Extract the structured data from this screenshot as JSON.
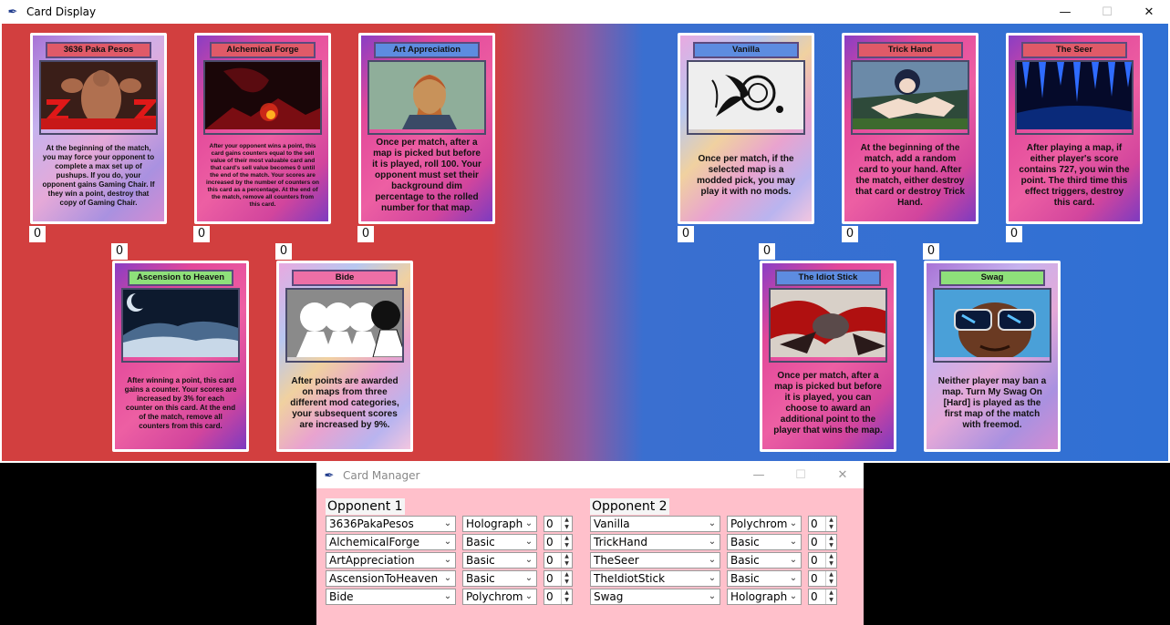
{
  "display_window": {
    "title": "Card Display",
    "controls": {
      "minimize": "—",
      "maximize": "☐",
      "close": "✕"
    }
  },
  "opponent1_cards": [
    {
      "name": "3636 Paka Pesos",
      "tier": "Holographic",
      "label_color": "#e05a68",
      "counter": "0",
      "text": "At the beginning of the match, you may force your opponent to complete a max set up of pushups. If you do, your opponent gains Gaming Chair. If they win a point, destroy that copy of Gaming Chair.",
      "art": "muscle-man-art"
    },
    {
      "name": "Alchemical Forge",
      "tier": "Basic",
      "label_color": "#e05a68",
      "counter": "0",
      "text": "After your opponent wins a point, this card gains counters equal to the sell value of their most valuable card and that card's sell value becomes 0 until the end of the match. Your scores are increased by the number of counters on this card as a percentage. At the end of the match, remove all counters from this card.",
      "art": "forge-fire-art"
    },
    {
      "name": "Art Appreciation",
      "tier": "Basic",
      "label_color": "#5d8ce0",
      "counter": "0",
      "text": "Once per match, after a map is picked but before it is played, roll 100. Your opponent must set their background dim percentage to the rolled number for that map.",
      "art": "portrait-painting-art"
    },
    {
      "name": "Ascension to Heaven",
      "tier": "Basic",
      "label_color": "#8ee07a",
      "counter": "0",
      "text": "After winning a point, this card gains a counter. Your scores are increased by 3% for each counter on this card. At the end of the match, remove all counters from this card.",
      "art": "cloud-planet-art"
    },
    {
      "name": "Bide",
      "tier": "Polychrome",
      "label_color": "#ee6fa6",
      "counter": "0",
      "text": "After points are awarded on maps from three different mod categories, your subsequent scores are increased by 9%.",
      "art": "anime-silhouette-art"
    }
  ],
  "opponent2_cards": [
    {
      "name": "Vanilla",
      "tier": "Polychrome",
      "label_color": "#5d8ce0",
      "counter": "0",
      "text": "Once per match, if the selected map is a modded pick, you may play it with no mods.",
      "art": "ink-splash-art"
    },
    {
      "name": "Trick Hand",
      "tier": "Basic",
      "label_color": "#e05a68",
      "counter": "0",
      "text": "At the beginning of the match, add a random card to your hand. After the match, either destroy that card or destroy Trick Hand.",
      "art": "anime-hand-art"
    },
    {
      "name": "The Seer",
      "tier": "Basic",
      "label_color": "#e05a68",
      "counter": "0",
      "text": "After playing a map, if either player's score contains 727, you win the point. The third time this effect triggers, destroy this card.",
      "art": "blue-crystal-art"
    },
    {
      "name": "The Idiot Stick",
      "tier": "Basic",
      "label_color": "#5d8ce0",
      "counter": "0",
      "text": "Once per match, after a map is picked but before it is played, you can choose to award an additional point to the player that wins the map.",
      "art": "red-chaos-art"
    },
    {
      "name": "Swag",
      "tier": "Holographic",
      "label_color": "#8ee07a",
      "counter": "0",
      "text": "Neither player may ban a map. Turn My Swag On [Hard] is played as the first map of the match with freemod.",
      "art": "sunglasses-man-art"
    }
  ],
  "manager_window": {
    "title": "Card Manager",
    "controls": {
      "minimize": "—",
      "maximize": "☐",
      "close": "✕"
    },
    "opponent1_label": "Opponent 1",
    "opponent2_label": "Opponent 2",
    "opponent1_rows": [
      {
        "card": "3636PakaPesos",
        "tier": "Holographic",
        "count": "0"
      },
      {
        "card": "AlchemicalForge",
        "tier": "Basic",
        "count": "0"
      },
      {
        "card": "ArtAppreciation",
        "tier": "Basic",
        "count": "0"
      },
      {
        "card": "AscensionToHeaven",
        "tier": "Basic",
        "count": "0"
      },
      {
        "card": "Bide",
        "tier": "Polychrome",
        "count": "0"
      }
    ],
    "opponent2_rows": [
      {
        "card": "Vanilla",
        "tier": "Polychrome",
        "count": "0"
      },
      {
        "card": "TrickHand",
        "tier": "Basic",
        "count": "0"
      },
      {
        "card": "TheSeer",
        "tier": "Basic",
        "count": "0"
      },
      {
        "card": "TheIdiotStick",
        "tier": "Basic",
        "count": "0"
      },
      {
        "card": "Swag",
        "tier": "Holographic",
        "count": "0"
      }
    ]
  },
  "colors": {
    "red_side": "#d23f3f",
    "blue_side": "#3070d4",
    "manager_bg": "#ffc0cb"
  }
}
